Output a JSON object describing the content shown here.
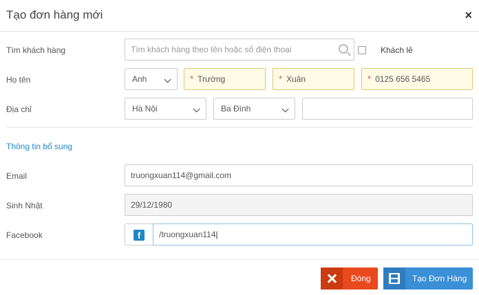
{
  "modal": {
    "title": "Tạo đơn hàng mới",
    "close_symbol": "×"
  },
  "search": {
    "label": "Tìm khách hàng",
    "placeholder": "Tìm khách hàng theo tên hoặc số điện thoại",
    "walkin_label": "Khách lẻ"
  },
  "name": {
    "label": "Họ tên",
    "title_value": "Anh",
    "last_name": "Trường",
    "first_name": "Xuân",
    "phone": "0125 656 5465"
  },
  "address": {
    "label": "Địa chỉ",
    "city": "Hà Nội",
    "district": "Ba Đình",
    "street": ""
  },
  "extra": {
    "section_title": "Thông tin bổ sung",
    "email_label": "Email",
    "email_value": "truongxuan114@gmail.com",
    "birthday_label": "Sinh Nhật",
    "birthday_value": "29/12/1980",
    "facebook_label": "Facebook",
    "facebook_value": "/truongxuan114",
    "facebook_icon_glyph": "f"
  },
  "footer": {
    "close_label": "Đóng",
    "create_label": "Tạo Đơn Hàng"
  },
  "colors": {
    "accent": "#1e88c7",
    "close_button": "#e8491d",
    "create_button": "#3a8fd6",
    "required_field_bg": "#fffbe6"
  }
}
